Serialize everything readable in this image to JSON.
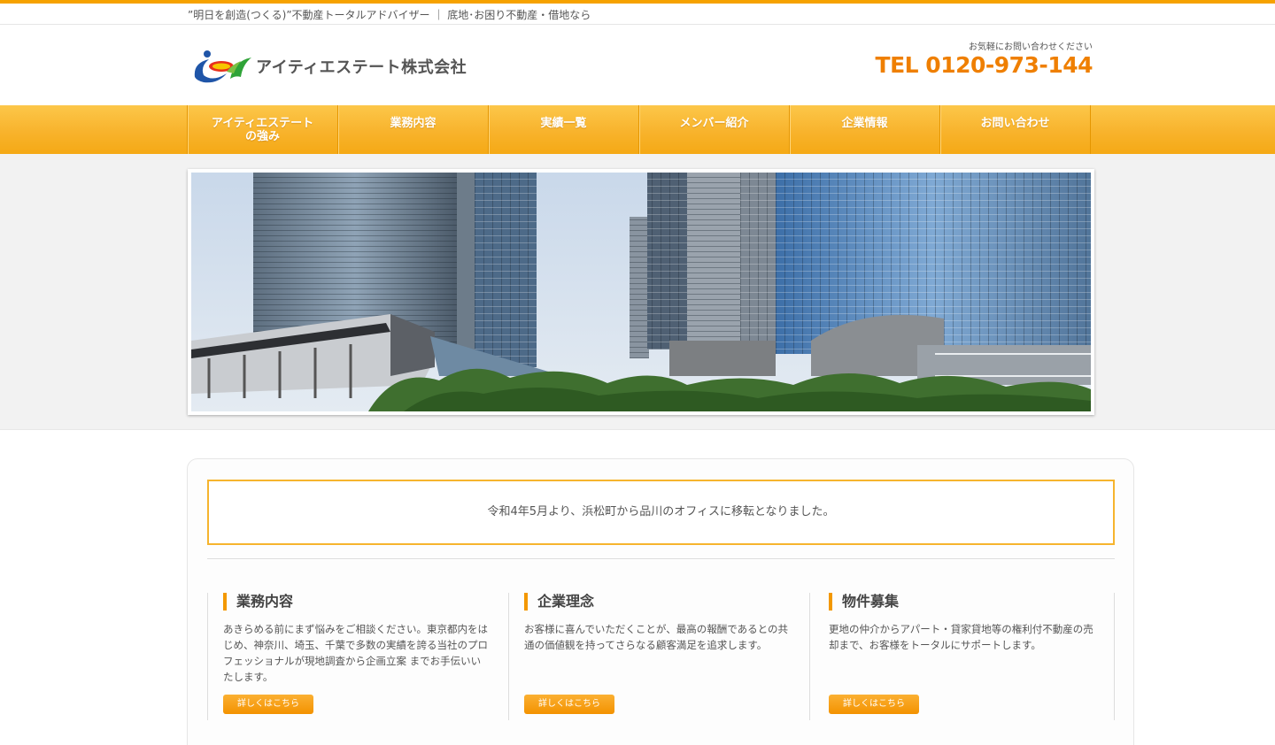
{
  "tagline": "”明日を創造(つくる)”不動産トータルアドバイザー ｜ 底地･お困り不動産・借地なら",
  "header": {
    "logo_text": "アイティエステート株式会社",
    "contact_note": "お気軽にお問い合わせください",
    "tel": "TEL 0120-973-144"
  },
  "nav": {
    "items": [
      {
        "line1": "アイティエステート",
        "line2": "の強み"
      },
      {
        "line1": "業務内容",
        "line2": ""
      },
      {
        "line1": "実績一覧",
        "line2": ""
      },
      {
        "line1": "メンバー紹介",
        "line2": ""
      },
      {
        "line1": "企業情報",
        "line2": ""
      },
      {
        "line1": "お問い合わせ",
        "line2": ""
      }
    ]
  },
  "notice": "令和4年5月より、浜松町から品川のオフィスに移転となりました。",
  "columns": [
    {
      "title": "業務内容",
      "text": "あきらめる前にまず悩みをご相談ください。東京都内をはじめ、神奈川、埼玉、千葉で多数の実績を誇る当社のプロフェッショナルが現地調査から企画立案 までお手伝いいたします。",
      "button": "詳しくはこちら"
    },
    {
      "title": "企業理念",
      "text": "お客様に喜んでいただくことが、最高の報酬であるとの共通の価値観を持ってさらなる顧客満足を追求します。",
      "button": "詳しくはこちら"
    },
    {
      "title": "物件募集",
      "text": "更地の仲介からアパート・貸家貸地等の権利付不動産の売却まで、お客様をトータルにサポートします。",
      "button": "詳しくはこちら"
    }
  ],
  "colors": {
    "accent": "#f39800",
    "tel": "#ef7f00",
    "nav": "#f8b32c"
  }
}
